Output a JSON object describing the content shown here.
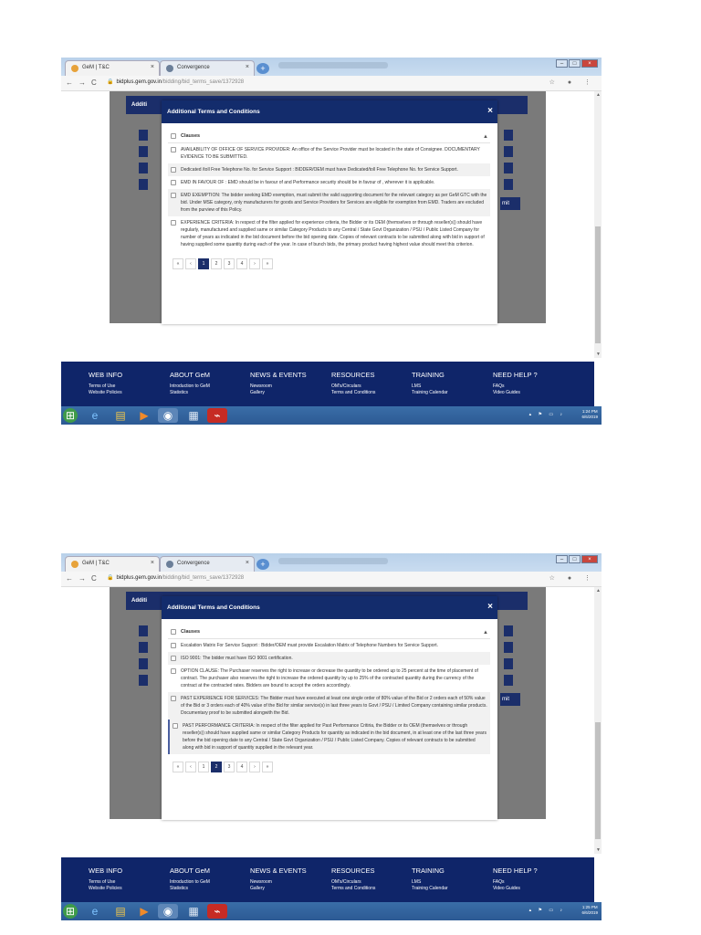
{
  "browser": {
    "tab1_title": "GeM | T&C",
    "tab2_title": "Convergence",
    "tab_close": "×",
    "new_tab": "+",
    "back": "←",
    "forward": "→",
    "reload": "C",
    "url_host": "bidplus.gem.gov.in",
    "url_path": "/bidding/bid_terms_save/1372928",
    "star": "☆"
  },
  "page": {
    "bg_header": "Additi",
    "bg_submit": "mit"
  },
  "modal": {
    "title": "Additional Terms and Conditions",
    "close": "×",
    "clauses_header": "Clauses"
  },
  "shot1": {
    "clauses": [
      "AVAILABILITY OF OFFICE OF SERVICE PROVIDER: An office of the Service Provider must be located in the state of Consignee. DOCUMENTARY EVIDENCE TO BE SUBMITTED.",
      "Dedicated /toll Free Telephone No. for Service Support : BIDDER/OEM must have Dedicated/toll Free Telephone No. for Service Support.",
      "EMD IN FAVOUR OF : EMD should be in favour of and Performance security should be in favour of , wherever it is applicable.",
      "EMD EXEMPTION: The bidder seeking EMD exemption, must submit the valid supporting document for the relevant category as per GeM GTC with the bid. Under MSE category, only manufacturers for goods and Service Providers for Services are eligible for exemption from EMD. Traders are excluded from the purview of this Policy.",
      "EXPERIENCE CRITERIA: In respect of the filter applied for experience criteria, the Bidder or its OEM (themselves or through reseller(s)) should have regularly, manufactured and supplied same or similar Category Products to any Central / State Govt Organization / PSU / Public Listed Company for number of years as indicated in the bid document before the bid opening date. Copies of relevant contracts to be submitted along with bid in support of having supplied some quantity during each of the year. In case of bunch bids, the primary product having highest value should meet this criterion."
    ],
    "pager": [
      "«",
      "‹",
      "1",
      "2",
      "3",
      "4",
      "›",
      "»"
    ],
    "active_page": "1",
    "clock_time": "1:24 PM",
    "clock_date": "6/6/2019"
  },
  "shot2": {
    "clauses": [
      "Escalation Matrix For Service Support : Bidder/OEM must provide Escalation Matrix of Telephone Numbers for Service Support.",
      "ISO 9001: The bidder must have ISO 9001 certification.",
      "OPTION CLAUSE: The Purchaser reserves the right to increase or decrease the quantity to be ordered up to 25 percent at the time of placement of contract. The purchaser also reserves the right to increase the ordered quantity by up to 25% of the contracted quantity during the currency of the contract at the contracted rates. Bidders are bound to accept the orders accordingly.",
      "PAST EXPERIENCE FOR SERVICES: The Bidder must have executed at least one single order of 80% value of the Bid or 2 orders each of 50% value of the Bid or 3 orders each of 40% value of the Bid for similar service(s) in last three years to Govt / PSU / Limited Company containing similar products. Documentary proof to be submitted alongwith the Bid.",
      "PAST PERFORMANCE CRITERIA: In respect of the filter applied for Past Performance Critiria, the Bidder or its OEM (themselves or through reseller(s)) should have supplied same or similar Category Products for quantity as indicated in the bid document, in at least one of the last three years before the bid opening date to any Central / State Govt Organization / PSU / Public Listed Company. Copies of relevant contracts to be submitted along with bid in support of quantity supplied in the relevant year."
    ],
    "pager": [
      "«",
      "‹",
      "1",
      "2",
      "3",
      "4",
      "›",
      "»"
    ],
    "active_page": "2",
    "clock_time": "1:25 PM",
    "clock_date": "6/6/2019"
  },
  "footer": {
    "columns": [
      {
        "heading": "WEB INFO",
        "links": [
          "Terms of Use",
          "Website Policies"
        ]
      },
      {
        "heading": "ABOUT GeM",
        "links": [
          "Introduction to GeM",
          "Statistics"
        ]
      },
      {
        "heading": "NEWS & EVENTS",
        "links": [
          "Newsroom",
          "Gallery"
        ]
      },
      {
        "heading": "RESOURCES",
        "links": [
          "OM's/Circulars",
          "Terms and Conditions"
        ]
      },
      {
        "heading": "TRAINING",
        "links": [
          "LMS",
          "Training Calendar"
        ]
      },
      {
        "heading": "NEED HELP ?",
        "links": [
          "FAQs",
          "Video Guides"
        ]
      }
    ]
  },
  "colors": {
    "navy": "#132c6c",
    "footer": "#0f2569",
    "taskbar": "#2c5a94"
  }
}
